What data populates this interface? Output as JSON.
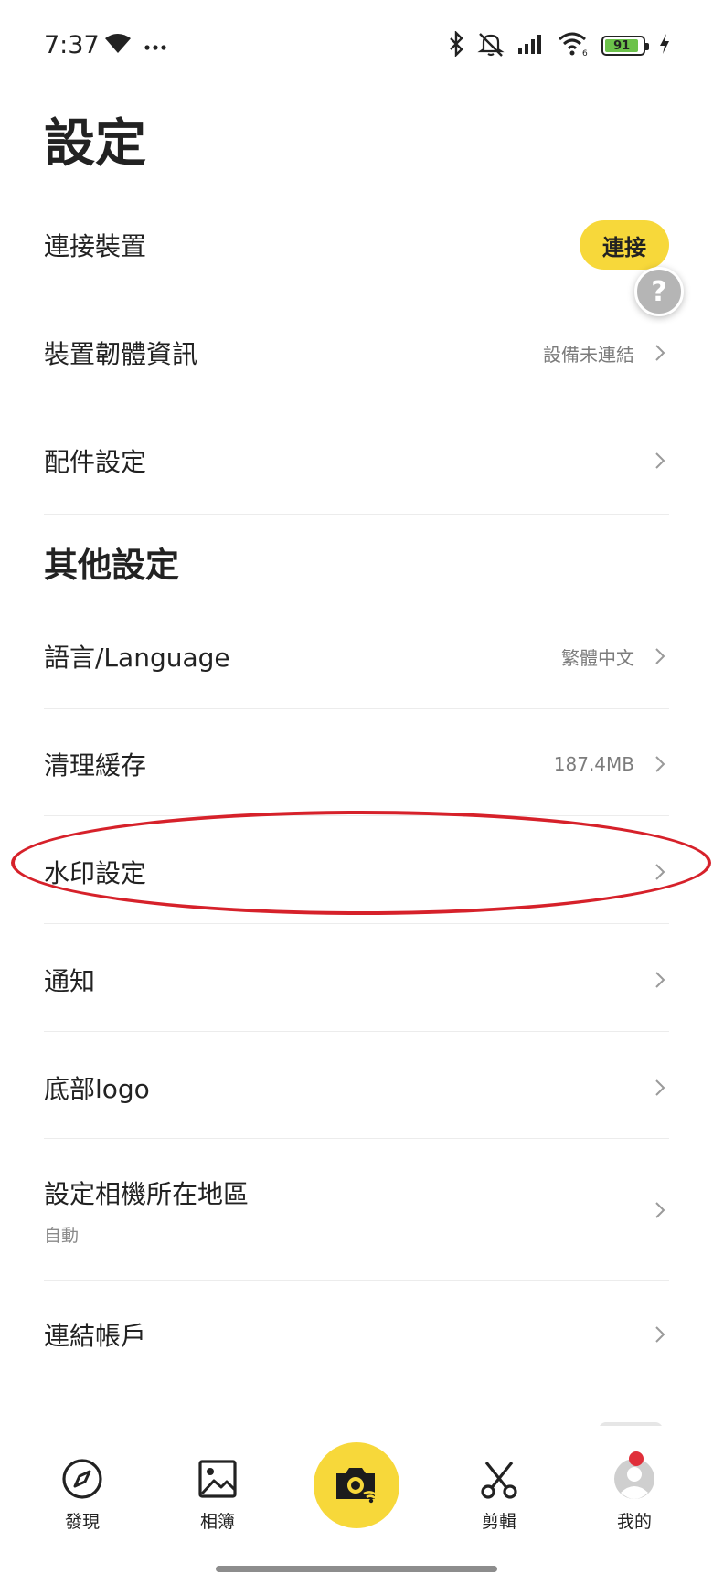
{
  "status_bar": {
    "time": "7:37",
    "battery": "91"
  },
  "header": {
    "title": "設定"
  },
  "rows": {
    "connect_device": {
      "label": "連接裝置",
      "button": "連接"
    },
    "firmware": {
      "label": "裝置韌體資訊",
      "value": "設備未連結"
    },
    "accessory": {
      "label": "配件設定"
    }
  },
  "other_section": {
    "title": "其他設定"
  },
  "other_rows": {
    "language": {
      "label": "語言/Language",
      "value": "繁體中文"
    },
    "cache": {
      "label": "清理緩存",
      "value": "187.4MB"
    },
    "watermark": {
      "label": "水印設定"
    },
    "notification": {
      "label": "通知"
    },
    "bottom_logo": {
      "label": "底部logo"
    },
    "region": {
      "label": "設定相機所在地區",
      "sub": "自動"
    },
    "account": {
      "label": "連結帳戶"
    }
  },
  "help": {
    "label": "?"
  },
  "bottom_nav": {
    "discover": "發現",
    "album": "相簿",
    "edit": "剪輯",
    "mine": "我的"
  },
  "colors": {
    "accent": "#f7d83a",
    "highlight": "#d6212a",
    "badge": "#e02f3a"
  },
  "icons": [
    "wifi-icon",
    "more-dots-icon",
    "bluetooth-icon",
    "bell-off-icon",
    "signal-icon",
    "wifi6-icon",
    "battery-icon",
    "charging-icon",
    "chevron-right-icon",
    "compass-icon",
    "image-icon",
    "camera-wifi-icon",
    "scissors-icon",
    "avatar-icon"
  ]
}
